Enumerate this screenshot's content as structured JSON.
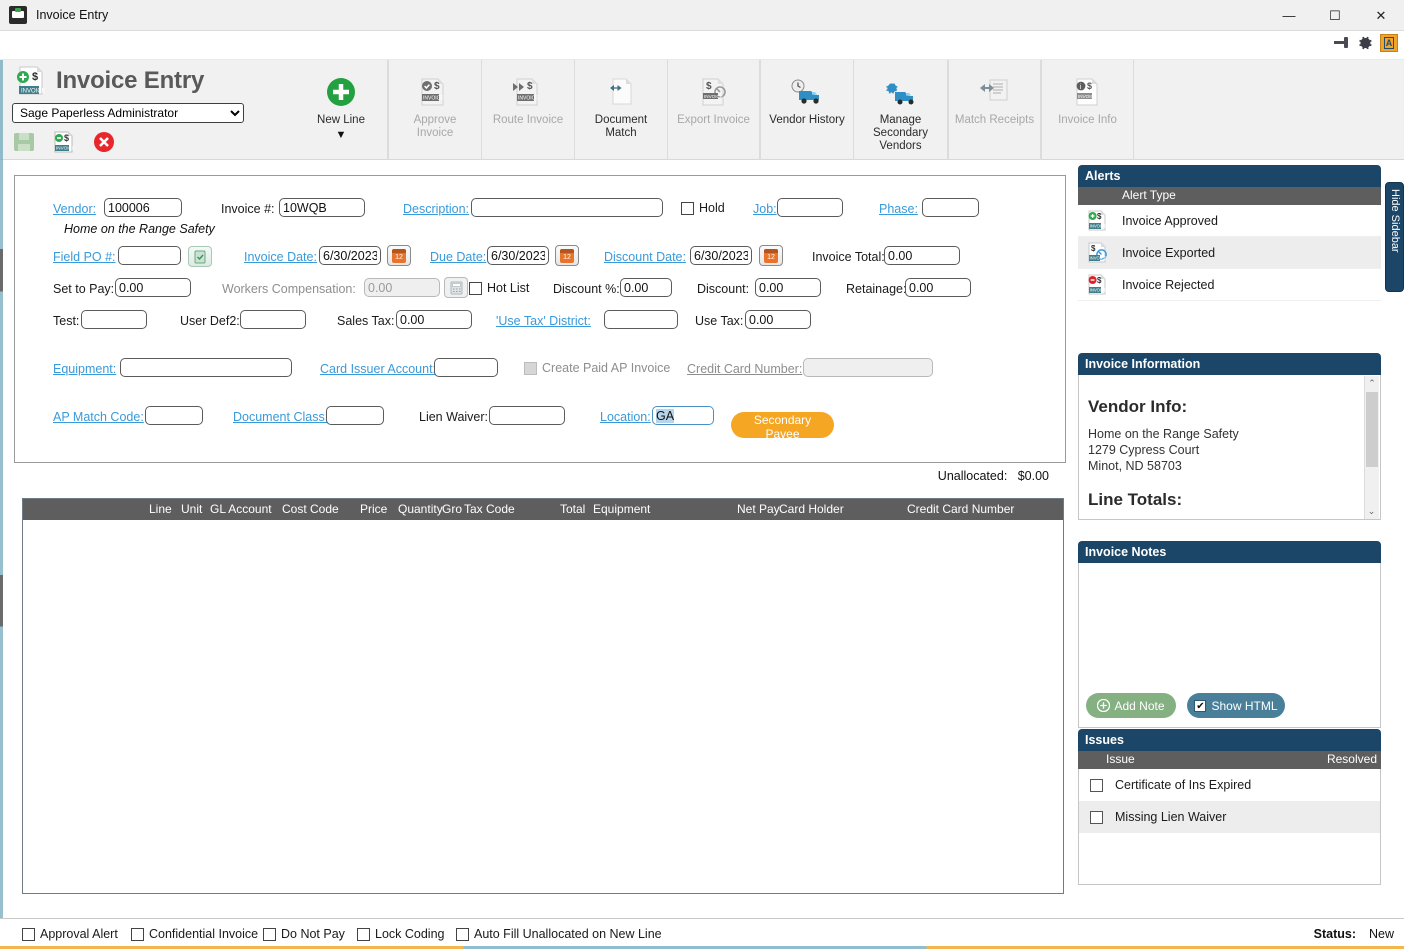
{
  "window": {
    "title": "Invoice Entry",
    "app_icon": "invoice-app-icon",
    "minimize": "—",
    "maximize": "☐",
    "close": "✕"
  },
  "subbar": {
    "pin_icon": "pin-icon",
    "gear_icon": "gear-icon",
    "annotate_label": "A"
  },
  "header": {
    "page_title": "Invoice Entry",
    "logo_icon": "invoice-new-icon",
    "user_selected": "Sage Paperless Administrator",
    "user_options": [
      "Sage Paperless Administrator"
    ],
    "doc_buttons": [
      {
        "name": "save-invoice-button",
        "icon": "floppy-disk-icon",
        "enabled": false
      },
      {
        "name": "save-and-new-invoice-button",
        "icon": "invoice-dollar-icon",
        "enabled": true
      },
      {
        "name": "cancel-invoice-button",
        "icon": "red-x-circle-icon",
        "enabled": true
      }
    ]
  },
  "ribbon": {
    "tools": [
      {
        "label": "New Line",
        "icon": "green-plus-circle-icon",
        "enabled": true,
        "caret": "▼"
      },
      {
        "label": "Approve\nInvoice",
        "icon": "approve-invoice-icon",
        "enabled": false
      },
      {
        "label": "Route Invoice",
        "icon": "route-invoice-icon",
        "enabled": false
      },
      {
        "label": "Document\nMatch",
        "icon": "document-match-icon",
        "enabled": true
      },
      {
        "label": "Export Invoice",
        "icon": "export-invoice-icon",
        "enabled": false
      },
      {
        "label": "Vendor History",
        "icon": "vendor-history-truck-icon",
        "enabled": true
      },
      {
        "label": "Manage\nSecondary\nVendors",
        "icon": "manage-secondary-vendors-icon",
        "enabled": true
      },
      {
        "label": "Match Receipts",
        "icon": "match-receipts-icon",
        "enabled": false
      },
      {
        "label": "Invoice Info",
        "icon": "invoice-info-icon",
        "enabled": false
      }
    ]
  },
  "form": {
    "vendor_label": "Vendor:",
    "vendor_value": "100006",
    "vendor_name": "Home on the Range Safety",
    "invoice_num_label": "Invoice #:",
    "invoice_num_value": "10WQB",
    "description_label": "Description:",
    "description_value": "",
    "hold_label": "Hold",
    "hold_checked": false,
    "job_label": "Job:",
    "job_value": "",
    "phase_label": "Phase:",
    "phase_value": "",
    "field_po_label": "Field PO #:",
    "field_po_value": "",
    "invoice_date_label": "Invoice Date:",
    "invoice_date_value": "6/30/2023",
    "due_date_label": "Due Date:",
    "due_date_value": "6/30/2023",
    "discount_date_label": "Discount Date:",
    "discount_date_value": "6/30/2023",
    "invoice_total_label": "Invoice Total:",
    "invoice_total_value": "0.00",
    "set_to_pay_label": "Set to Pay:",
    "set_to_pay_value": "0.00",
    "workers_comp_label": "Workers Compensation:",
    "workers_comp_value": "0.00",
    "hot_list_label": "Hot List",
    "hot_list_checked": false,
    "discount_pct_label": "Discount %:",
    "discount_pct_value": "0.00",
    "discount_label": "Discount:",
    "discount_value": "0.00",
    "retainage_label": "Retainage:",
    "retainage_value": "0.00",
    "test_label": "Test:",
    "test_value": "",
    "user_def2_label": "User Def2:",
    "user_def2_value": "",
    "sales_tax_label": "Sales Tax:",
    "sales_tax_value": "0.00",
    "use_tax_district_label": "'Use Tax' District:",
    "use_tax_district_value": "",
    "use_tax_label": "Use Tax:",
    "use_tax_value": "0.00",
    "equipment_label": "Equipment:",
    "equipment_value": "",
    "card_issuer_label": "Card Issuer Account:",
    "card_issuer_value": "",
    "create_paid_ap_label": "Create Paid AP Invoice",
    "create_paid_ap_checked": false,
    "credit_card_number_label": "Credit Card Number:",
    "credit_card_number_value": "",
    "ap_match_code_label": "AP Match Code:",
    "ap_match_code_value": "",
    "document_class_label": "Document Class:",
    "document_class_value": "",
    "lien_waiver_label": "Lien Waiver:",
    "lien_waiver_value": "",
    "location_label": "Location:",
    "location_value": "GA",
    "secondary_payee_button": "Secondary Payee"
  },
  "grid": {
    "unallocated_label": "Unallocated:",
    "unallocated_value": "$0.00",
    "columns": [
      "Line",
      "Unit",
      "GL Account",
      "Cost Code",
      "Price",
      "Quantity",
      "Gro",
      "Tax Code",
      "Total",
      "Equipment",
      "Net Pay",
      "Card Holder",
      "Credit Card Number"
    ],
    "rows": []
  },
  "sidebar": {
    "alerts": {
      "title": "Alerts",
      "column_header": "Alert Type",
      "items": [
        {
          "label": "Invoice Approved",
          "icon": "invoice-approved-icon"
        },
        {
          "label": "Invoice Exported",
          "icon": "invoice-exported-icon"
        },
        {
          "label": "Invoice Rejected",
          "icon": "invoice-rejected-icon"
        }
      ]
    },
    "invoice_information": {
      "title": "Invoice Information",
      "vendor_info_heading": "Vendor Info:",
      "vendor_name": "Home on the Range Safety",
      "vendor_street": "1279 Cypress Court",
      "vendor_city": "Minot, ND 58703",
      "line_totals_heading": "Line Totals:",
      "scroll_up": "⌃",
      "scroll_down": "⌄"
    },
    "invoice_notes": {
      "title": "Invoice Notes",
      "body": "",
      "add_note_button": "Add Note",
      "add_note_icon": "plus-circle-icon",
      "show_html_button": "Show HTML",
      "show_html_checked": true
    },
    "issues": {
      "title": "Issues",
      "col_issue": "Issue",
      "col_resolved": "Resolved",
      "rows": [
        {
          "issue": "Certificate of Ins Expired",
          "resolved": false
        },
        {
          "issue": "Missing Lien Waiver",
          "resolved": false
        }
      ]
    },
    "hide_sidebar_tab": "Hide Sidebar"
  },
  "bottom": {
    "checkboxes": [
      {
        "label": "Approval Alert",
        "checked": false
      },
      {
        "label": "Confidential Invoice",
        "checked": false
      },
      {
        "label": "Do Not Pay",
        "checked": false
      },
      {
        "label": "Lock Coding",
        "checked": false
      },
      {
        "label": "Auto Fill Unallocated on New Line",
        "checked": false
      }
    ],
    "status_label": "Status:",
    "status_value": "New"
  },
  "colors": {
    "panel_header": "#1b4668",
    "grid_header": "#5e5e5e",
    "accent_orange": "#f5a623",
    "link_blue": "#3a9ad9",
    "add_note_green": "#84b082",
    "show_html_blue": "#4a7f99"
  }
}
